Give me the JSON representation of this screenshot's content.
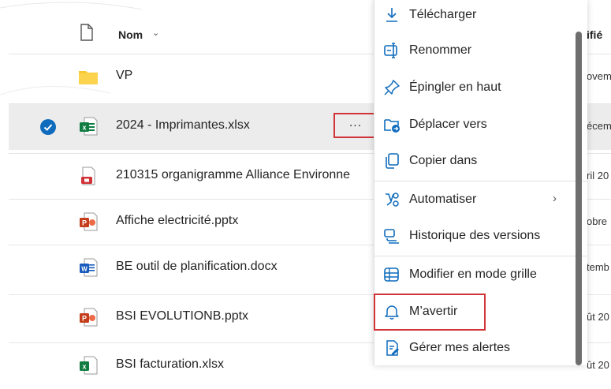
{
  "header": {
    "name_label": "Nom",
    "name_sort_icon": "chevron-down-icon",
    "modified_label": "ifié"
  },
  "rows": [
    {
      "name": "VP",
      "type": "folder",
      "modified": "ovem"
    },
    {
      "name": "2024 - Imprimantes.xlsx",
      "type": "excel",
      "modified": "écem",
      "selected": true
    },
    {
      "name": "210315 organigramme Alliance Environne",
      "type": "pdf",
      "modified": "ril 20"
    },
    {
      "name": "Affiche electricité.pptx",
      "type": "powerpoint",
      "modified": "obre"
    },
    {
      "name": "BE outil de planification.docx",
      "type": "word",
      "modified": "temb"
    },
    {
      "name": "BSI EVOLUTIONB.pptx",
      "type": "powerpoint",
      "modified": "ût 20"
    },
    {
      "name": "BSI facturation.xlsx",
      "type": "excel",
      "modified": "ût 20"
    }
  ],
  "more_actions": {
    "label": "...",
    "icon": "more-horizontal-icon"
  },
  "context_menu": {
    "items": [
      {
        "label": "Télécharger",
        "icon": "download-icon"
      },
      {
        "label": "Renommer",
        "icon": "rename-icon"
      },
      {
        "label": "Épingler en haut",
        "icon": "pin-icon"
      },
      {
        "label": "Déplacer vers",
        "icon": "move-folder-icon"
      },
      {
        "label": "Copier dans",
        "icon": "copy-icon"
      },
      {
        "label": "Automatiser",
        "icon": "automate-icon",
        "submenu": true
      },
      {
        "label": "Historique des versions",
        "icon": "history-icon"
      },
      {
        "label": "Modifier en mode grille",
        "icon": "grid-edit-icon"
      },
      {
        "label": "M’avertir",
        "icon": "bell-icon"
      },
      {
        "label": "Gérer mes alertes",
        "icon": "manage-alerts-icon"
      }
    ]
  },
  "colors": {
    "highlight_box": "#d13438",
    "selected_row": "#ececec",
    "check_blue": "#0f6cbd",
    "folder": "#f8c930",
    "excel": "#107c41",
    "word": "#185abd",
    "powerpoint": "#c43e1c",
    "pdf": "#d13438"
  }
}
